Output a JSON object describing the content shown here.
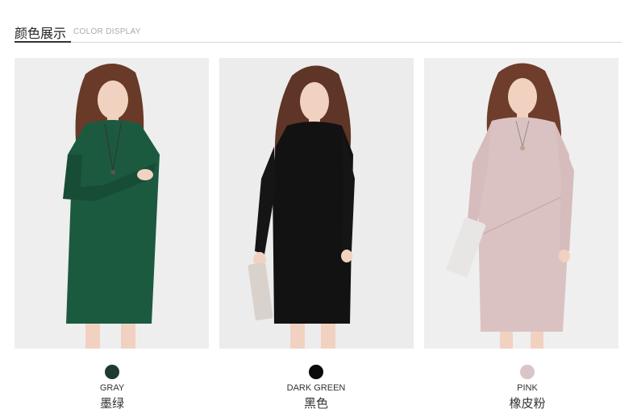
{
  "header": {
    "title_cn": "颜色展示",
    "title_en": "COLOR DISPLAY"
  },
  "photos": [
    {
      "dress_color": "#1c5a40",
      "bg_color": "#eeeeee"
    },
    {
      "dress_color": "#121212",
      "bg_color": "#ececec"
    },
    {
      "dress_color": "#dbc2c2",
      "bg_color": "#efefef"
    }
  ],
  "colors": [
    {
      "label_en": "GRAY",
      "label_cn": "墨绿",
      "swatch": "#1f3a30"
    },
    {
      "label_en": "DARK GREEN",
      "label_cn": "黑色",
      "swatch": "#0a0a0a"
    },
    {
      "label_en": "PINK",
      "label_cn": "橡皮粉",
      "swatch": "#d9c5c7"
    }
  ]
}
